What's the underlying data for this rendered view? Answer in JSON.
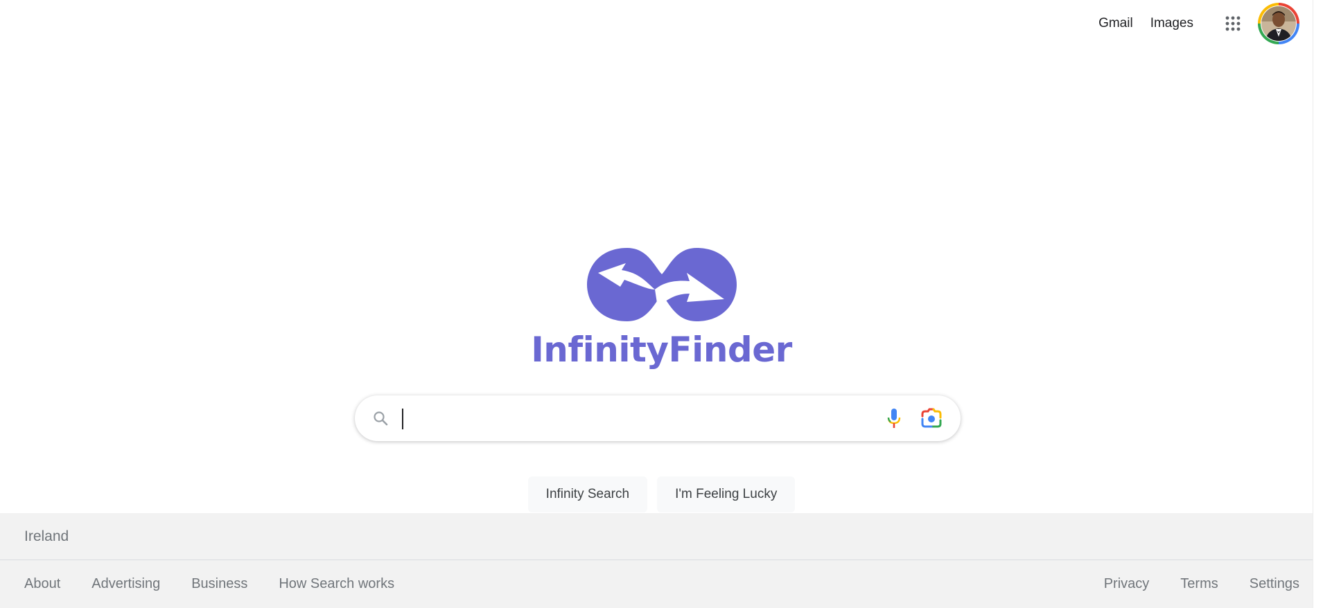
{
  "header": {
    "gmail_label": "Gmail",
    "images_label": "Images",
    "apps_icon": "apps-grid-icon",
    "avatar_icon": "user-avatar"
  },
  "logo": {
    "text": "InfinityFinder",
    "color": "#6a68d2"
  },
  "search": {
    "value": "",
    "placeholder": "",
    "icons": [
      "search-icon",
      "microphone-icon",
      "camera-lens-icon"
    ]
  },
  "buttons": {
    "search_label": "Infinity Search",
    "lucky_label": "I'm Feeling Lucky"
  },
  "footer": {
    "country": "Ireland",
    "left_links": [
      "About",
      "Advertising",
      "Business",
      "How Search works"
    ],
    "right_links": [
      "Privacy",
      "Terms",
      "Settings"
    ],
    "background": "#f2f2f2"
  }
}
